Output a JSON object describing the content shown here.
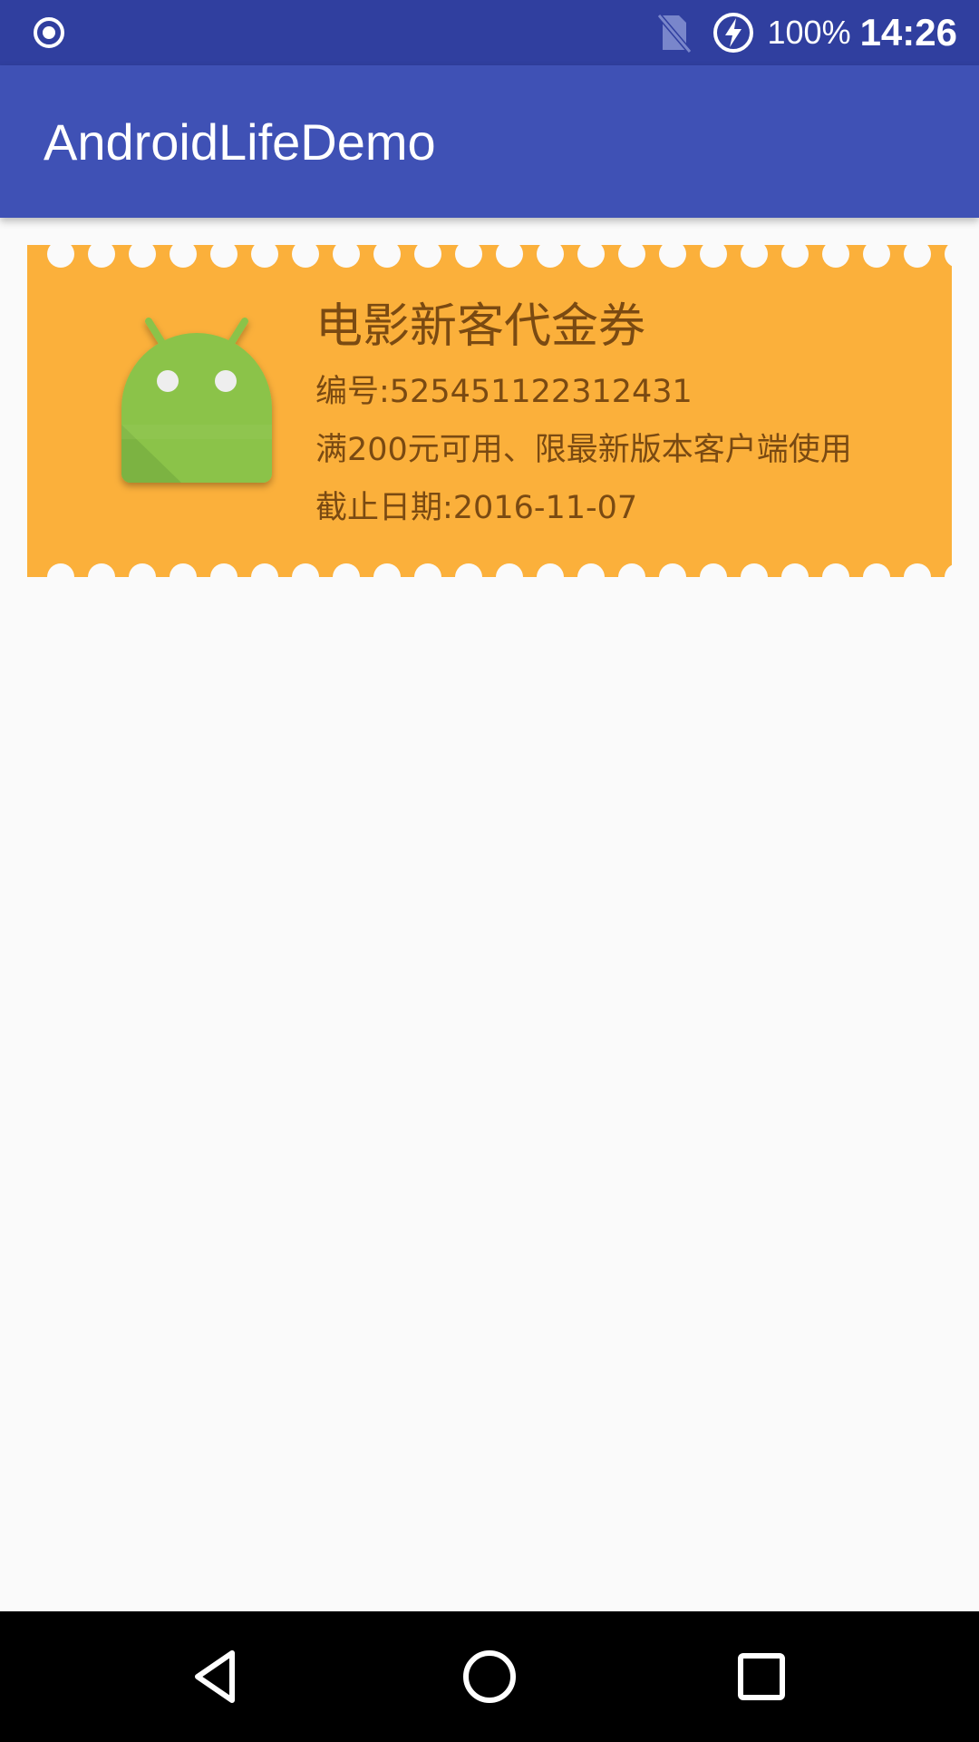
{
  "status_bar": {
    "battery_percent": "100%",
    "time": "14:26",
    "icons": [
      "record-icon",
      "no-sim-icon",
      "battery-charging-icon"
    ]
  },
  "app_bar": {
    "title": "AndroidLifeDemo"
  },
  "coupon": {
    "title": "电影新客代金券",
    "number": "编号:525451122312431",
    "condition": "满200元可用、限最新版本客户端使用",
    "expiry": "截止日期:2016-11-07",
    "background_color": "#fbb03b",
    "text_color": "#7a4a12",
    "logo_icon": "android-icon"
  },
  "nav_bar": {
    "icons": [
      "back-icon",
      "home-icon",
      "recents-icon"
    ]
  },
  "colors": {
    "status_bar": "#303f9f",
    "app_bar": "#3f51b5",
    "background": "#fafafa"
  }
}
